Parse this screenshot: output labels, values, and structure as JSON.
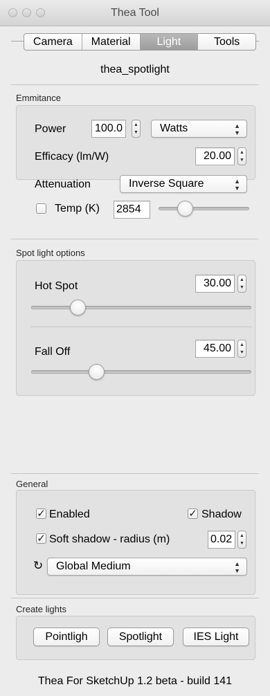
{
  "window": {
    "title": "Thea Tool"
  },
  "tabs": [
    {
      "label": "Camera",
      "active": false
    },
    {
      "label": "Material",
      "active": false
    },
    {
      "label": "Light",
      "active": true
    },
    {
      "label": "Tools",
      "active": false
    }
  ],
  "light_name": "thea_spotlight",
  "emmitance": {
    "section_label": "Emmitance",
    "power": {
      "label": "Power",
      "value": "100.0",
      "unit": "Watts"
    },
    "efficacy": {
      "label": "Efficacy (lm/W)",
      "value": "20.00"
    },
    "attenuation": {
      "label": "Attenuation",
      "value": "Inverse Square"
    },
    "temp": {
      "label": "Temp (K)",
      "checked": false,
      "value": "2854",
      "slider_fraction": 0.25
    }
  },
  "spot": {
    "section_label": "Spot light options",
    "hot_spot": {
      "label": "Hot Spot",
      "value": "30.00",
      "slider_fraction": 0.19
    },
    "fall_off": {
      "label": "Fall Off",
      "value": "45.00",
      "slider_fraction": 0.28
    }
  },
  "general": {
    "section_label": "General",
    "enabled": {
      "label": "Enabled",
      "checked": true
    },
    "shadow": {
      "label": "Shadow",
      "checked": true
    },
    "soft_shadow": {
      "label": "Soft shadow - radius (m)",
      "checked": true,
      "value": "0.02"
    },
    "medium": {
      "value": "Global Medium"
    }
  },
  "create_lights": {
    "section_label": "Create lights",
    "buttons": [
      "Pointligh",
      "Spotlight",
      "IES Light"
    ]
  },
  "footer": "Thea For SketchUp 1.2 beta - build 141",
  "icons": {
    "check": "✓",
    "refresh": "↻",
    "up_down": "⇕"
  }
}
